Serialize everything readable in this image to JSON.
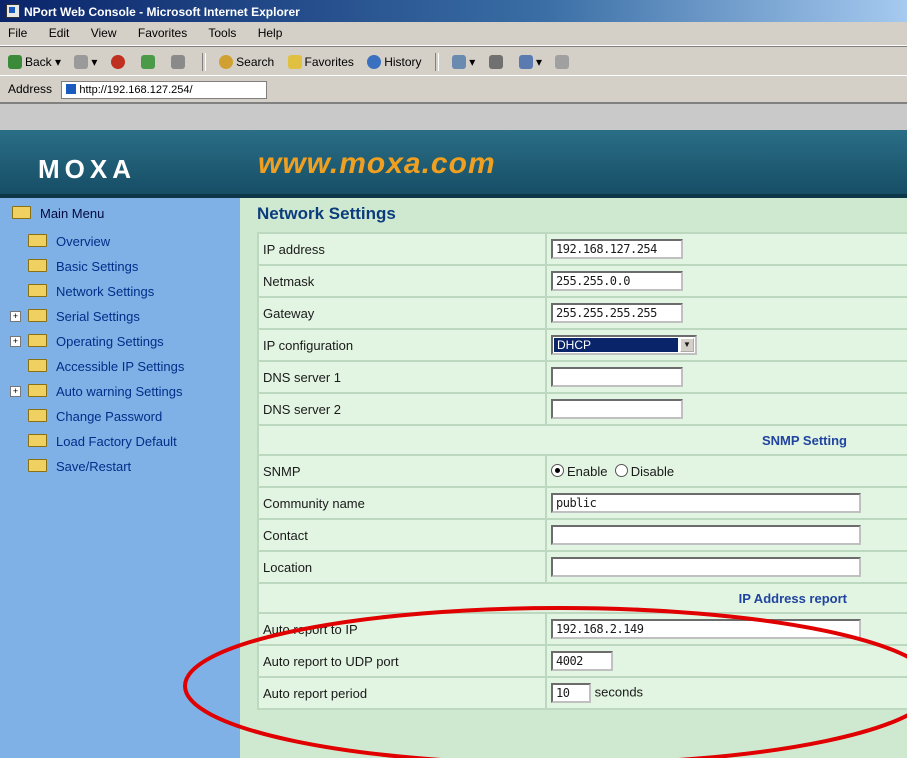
{
  "window": {
    "title": "NPort Web Console - Microsoft Internet Explorer"
  },
  "menu": [
    "File",
    "Edit",
    "View",
    "Favorites",
    "Tools",
    "Help"
  ],
  "toolbar": {
    "back": "Back",
    "search": "Search",
    "favorites": "Favorites",
    "history": "History"
  },
  "address": {
    "label": "Address",
    "url": "http://192.168.127.254/"
  },
  "header": {
    "logo": "MOXA",
    "url": "www.moxa.com"
  },
  "sidebar": {
    "root": "Main Menu",
    "items": [
      {
        "label": "Overview"
      },
      {
        "label": "Basic Settings"
      },
      {
        "label": "Network Settings"
      },
      {
        "label": "Serial Settings"
      },
      {
        "label": "Operating Settings"
      },
      {
        "label": "Accessible IP Settings"
      },
      {
        "label": "Auto warning Settings"
      },
      {
        "label": "Change Password"
      },
      {
        "label": "Load Factory Default"
      },
      {
        "label": "Save/Restart"
      }
    ]
  },
  "page": {
    "title": "Network Settings"
  },
  "form": {
    "ip_address": {
      "label": "IP address",
      "value": "192.168.127.254"
    },
    "netmask": {
      "label": "Netmask",
      "value": "255.255.0.0"
    },
    "gateway": {
      "label": "Gateway",
      "value": "255.255.255.255"
    },
    "ip_config": {
      "label": "IP configuration",
      "value": "DHCP"
    },
    "dns1": {
      "label": "DNS server 1",
      "value": ""
    },
    "dns2": {
      "label": "DNS server 2",
      "value": ""
    },
    "snmp_section": "SNMP Setting",
    "snmp": {
      "label": "SNMP",
      "enable": "Enable",
      "disable": "Disable",
      "selected": "Enable"
    },
    "community": {
      "label": "Community name",
      "value": "public"
    },
    "contact": {
      "label": "Contact",
      "value": ""
    },
    "location": {
      "label": "Location",
      "value": ""
    },
    "ipreport_section": "IP Address report",
    "report_ip": {
      "label": "Auto report to IP",
      "value": "192.168.2.149"
    },
    "report_port": {
      "label": "Auto report to UDP port",
      "value": "4002"
    },
    "report_period": {
      "label": "Auto report period",
      "value": "10",
      "unit": "seconds"
    }
  },
  "colors": {
    "header_bg": "#1d5d76",
    "url_accent": "#f0a020",
    "sidebar_bg": "#7fb0e6",
    "content_bg": "#cfe9d0",
    "annotation": "#e00000"
  }
}
